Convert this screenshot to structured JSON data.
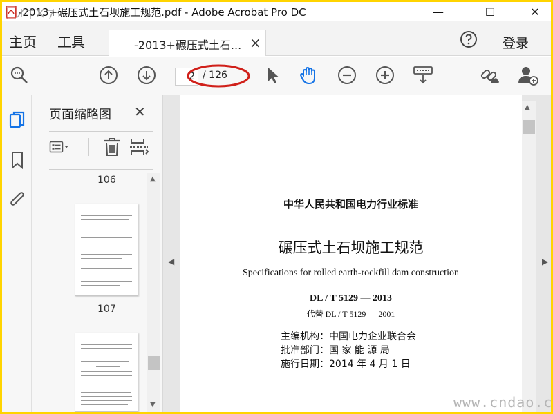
{
  "window": {
    "title": "-2013+碾压式土石坝施工规范.pdf - Adobe Acrobat Pro DC",
    "minimize_glyph": "—",
    "maximize_glyph": "☐",
    "close_glyph": "✕"
  },
  "menubar": {
    "home": "主页",
    "tools": "工具",
    "tab_label": "-2013+碾压式土石...",
    "tab_close": "×",
    "login": "登录"
  },
  "toolbar": {
    "page_current": "2",
    "page_total": "/ 126",
    "icons": [
      "zoom-search-icon",
      "prev-page-icon",
      "next-page-icon",
      "select-cursor-icon",
      "hand-tool-icon",
      "zoom-out-icon",
      "zoom-in-icon",
      "keyboard-icon",
      "share-link-icon",
      "add-user-icon"
    ],
    "hand_tool_color": "#1473e6",
    "annotation_color": "#d0201a"
  },
  "panel": {
    "title": "页面缩略图",
    "close": "✕",
    "thumbnails": [
      {
        "label": "106"
      },
      {
        "label": "107"
      }
    ]
  },
  "document": {
    "org": "中华人民共和国电力行业标准",
    "title_cn": "碾压式土石坝施工规范",
    "title_en": "Specifications for rolled earth-rockfill dam construction",
    "code": "DL / T   5129 — 2013",
    "replaces": "代替 DL / T   5129 — 2001",
    "editor": "主编机构：中国电力企业联合会",
    "approver": "批准部门：国   家   能   源   局",
    "effective": "施行日期：2014  年   4  月  1  日"
  },
  "watermark": "www.cndao.com",
  "colors": {
    "frame": "#ffd400",
    "accent": "#1473e6",
    "icon": "#555555"
  }
}
